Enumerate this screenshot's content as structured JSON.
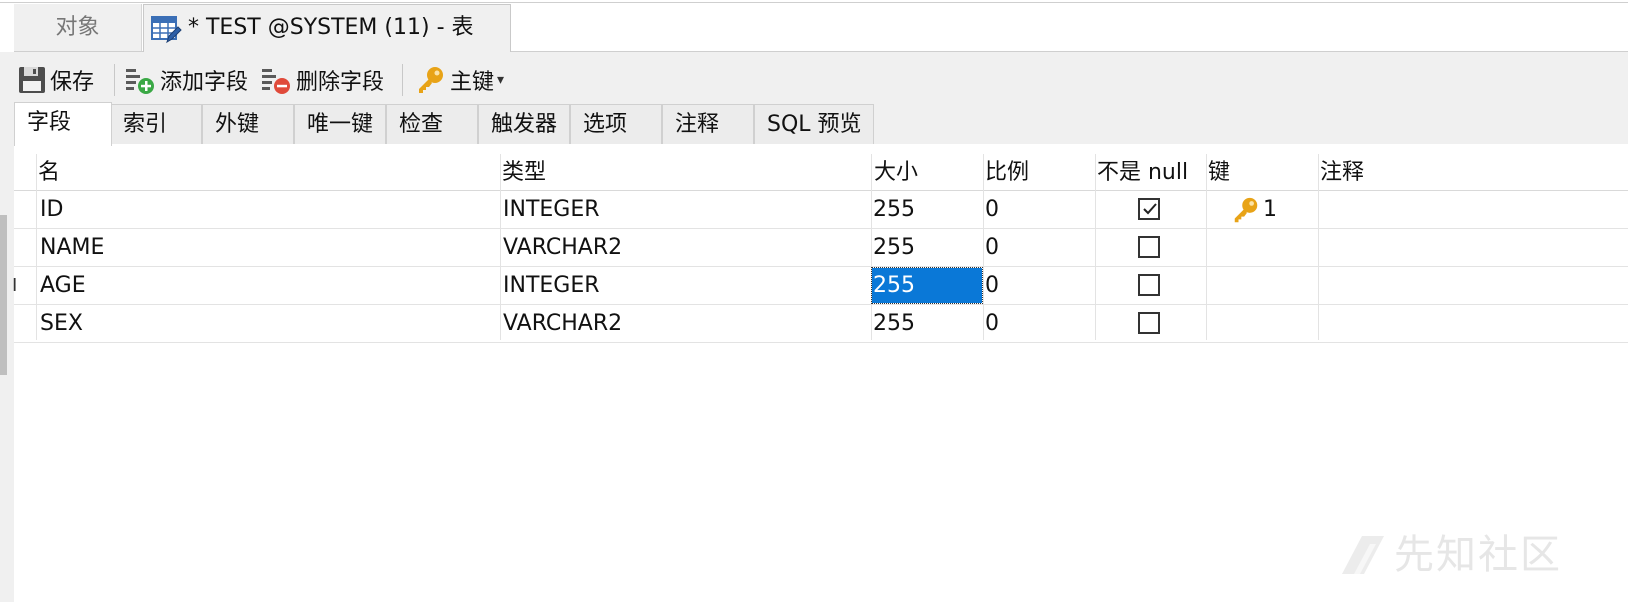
{
  "top_tabs": {
    "objects_label": "对象",
    "document_label": "* TEST @SYSTEM (11) - 表"
  },
  "toolbar": {
    "save_label": "保存",
    "add_field_label": "添加字段",
    "delete_field_label": "删除字段",
    "primary_key_label": "主键",
    "primary_key_caret": "▾"
  },
  "subtabs": [
    "字段",
    "索引",
    "外键",
    "唯一键",
    "检查",
    "触发器",
    "选项",
    "注释",
    "SQL 预览"
  ],
  "grid": {
    "columns": [
      "名",
      "类型",
      "大小",
      "比例",
      "不是 null",
      "键",
      "注释"
    ],
    "rows": [
      {
        "name": "ID",
        "type": "INTEGER",
        "size": "255",
        "scale": "0",
        "not_null": true,
        "key": "1",
        "comment": ""
      },
      {
        "name": "NAME",
        "type": "VARCHAR2",
        "size": "255",
        "scale": "0",
        "not_null": false,
        "key": "",
        "comment": ""
      },
      {
        "name": "AGE",
        "type": "INTEGER",
        "size": "255",
        "scale": "0",
        "not_null": false,
        "key": "",
        "comment": ""
      },
      {
        "name": "SEX",
        "type": "VARCHAR2",
        "size": "255",
        "scale": "0",
        "not_null": false,
        "key": "",
        "comment": ""
      }
    ],
    "current_row_marker": "I",
    "selected_cell": {
      "row": 2,
      "column": "size"
    }
  },
  "watermark": {
    "text": "先知社区"
  },
  "colors": {
    "selection": "#0a78d7",
    "key_icon": "#e8a317",
    "add_icon": "#3aa845",
    "delete_icon": "#e04a3a"
  },
  "icons": {
    "document_tab": "table-edit-icon",
    "save": "save-disk-icon",
    "add_field": "add-field-icon",
    "delete_field": "delete-field-icon",
    "primary_key": "key-icon",
    "key_cell": "key-icon"
  }
}
